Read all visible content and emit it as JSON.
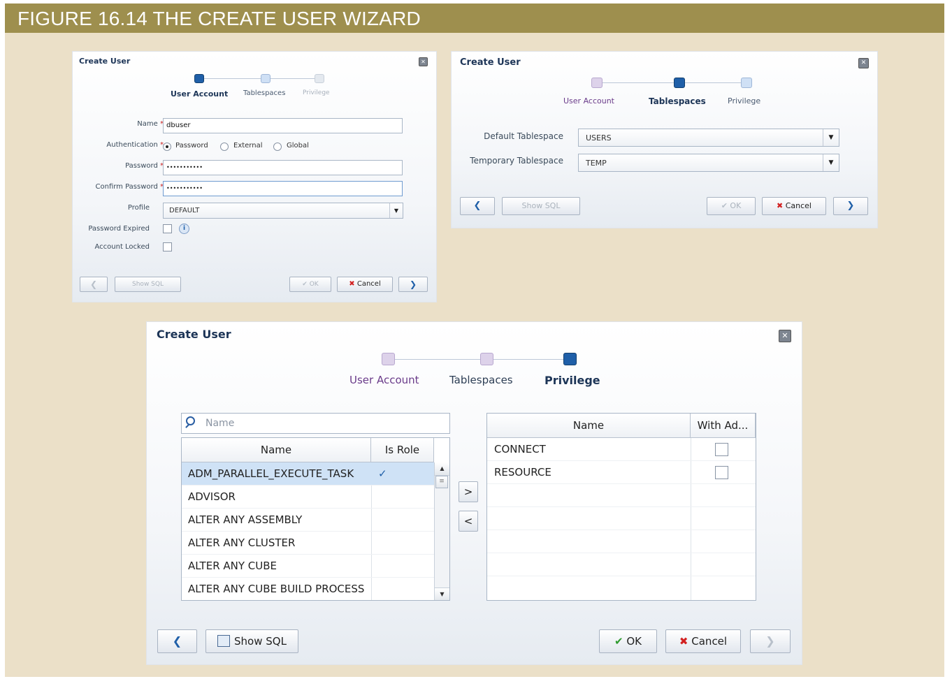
{
  "figure": {
    "title": "FIGURE 16.14  THE CREATE USER WIZARD"
  },
  "dialog1": {
    "title": "Create User",
    "steps": [
      "User Account",
      "Tablespaces",
      "Privilege"
    ],
    "fields": {
      "name_label": "Name",
      "name_value": "dbuser",
      "auth_label": "Authentication",
      "auth_options": [
        "Password",
        "External",
        "Global"
      ],
      "password_label": "Password",
      "password_value": "•••••••••••",
      "confirm_label": "Confirm Password",
      "confirm_value": "•••••••••••",
      "profile_label": "Profile",
      "profile_value": "DEFAULT",
      "expired_label": "Password Expired",
      "locked_label": "Account Locked"
    },
    "buttons": {
      "show_sql": "Show SQL",
      "ok": "OK",
      "cancel": "Cancel"
    }
  },
  "dialog2": {
    "title": "Create User",
    "steps": [
      "User Account",
      "Tablespaces",
      "Privilege"
    ],
    "fields": {
      "default_ts_label": "Default Tablespace",
      "default_ts_value": "USERS",
      "temp_ts_label": "Temporary Tablespace",
      "temp_ts_value": "TEMP"
    },
    "buttons": {
      "show_sql": "Show SQL",
      "ok": "OK",
      "cancel": "Cancel"
    }
  },
  "dialog3": {
    "title": "Create User",
    "steps": [
      "User Account",
      "Tablespaces",
      "Privilege"
    ],
    "search_placeholder": "Name",
    "available": {
      "headers": [
        "Name",
        "Is Role"
      ],
      "rows": [
        "ADM_PARALLEL_EXECUTE_TASK",
        "ADVISOR",
        "ALTER ANY ASSEMBLY",
        "ALTER ANY CLUSTER",
        "ALTER ANY CUBE",
        "ALTER ANY CUBE BUILD PROCESS"
      ],
      "role_check": "✓"
    },
    "move_right": ">",
    "move_left": "<",
    "granted": {
      "headers": [
        "Name",
        "With Ad..."
      ],
      "rows": [
        "CONNECT",
        "RESOURCE"
      ]
    },
    "buttons": {
      "show_sql": "Show SQL",
      "ok": "OK",
      "cancel": "Cancel"
    }
  }
}
